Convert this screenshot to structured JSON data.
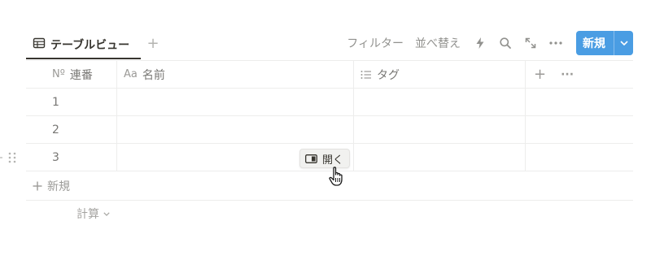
{
  "view_bar": {
    "tab_label": "テーブルビュー",
    "add_view": "+",
    "tools": {
      "filter": "フィルター",
      "sort": "並べ替え"
    },
    "new_button": "新規"
  },
  "table": {
    "columns": [
      {
        "icon": "Nº",
        "label": "連番"
      },
      {
        "icon": "Aa",
        "label": "名前"
      },
      {
        "icon": "list-icon",
        "label": "タグ"
      }
    ],
    "add_column": "+",
    "more": "···",
    "rows": [
      {
        "num": "1"
      },
      {
        "num": "2"
      },
      {
        "num": "3"
      }
    ]
  },
  "open_button": "開く",
  "new_row_label": "新規",
  "calc_label": "計算",
  "colors": {
    "accent": "#4a9de3",
    "text": "#37352f",
    "muted": "#91918e",
    "border": "#ededec"
  }
}
